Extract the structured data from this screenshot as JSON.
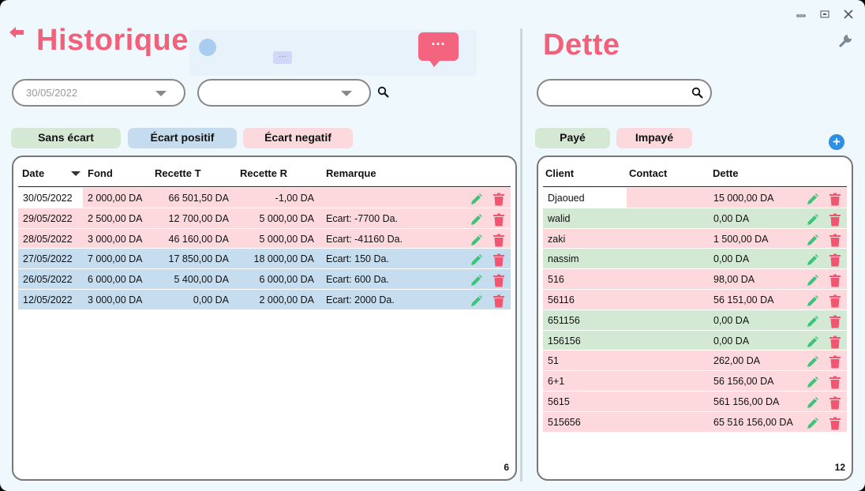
{
  "window": {
    "controls": [
      "minimize-icon",
      "restore-icon",
      "close-icon"
    ]
  },
  "historique": {
    "title": "Historique",
    "date_combo": {
      "value": "30/05/2022"
    },
    "second_combo": {
      "value": ""
    },
    "filters": {
      "sans_ecart": "Sans écart",
      "ecart_positif": "Écart positif",
      "ecart_negatif": "Écart negatif"
    },
    "columns": {
      "date": "Date",
      "fond": "Fond",
      "recette_t": "Recette T",
      "recette_r": "Recette R",
      "remarque": "Remarque"
    },
    "rows": [
      {
        "date": "30/05/2022",
        "fond": "2 000,00 DA",
        "recette_t": "66 501,50 DA",
        "recette_r": "-1,00 DA",
        "remarque": "",
        "status": "pink",
        "first": true
      },
      {
        "date": "29/05/2022",
        "fond": "2 500,00 DA",
        "recette_t": "12 700,00 DA",
        "recette_r": "5 000,00 DA",
        "remarque": "Ecart: -7700 Da.",
        "status": "pink"
      },
      {
        "date": "28/05/2022",
        "fond": "3 000,00 DA",
        "recette_t": "46 160,00 DA",
        "recette_r": "5 000,00 DA",
        "remarque": "Ecart: -41160 Da.",
        "status": "pink"
      },
      {
        "date": "27/05/2022",
        "fond": "7 000,00 DA",
        "recette_t": "17 850,00 DA",
        "recette_r": "18 000,00 DA",
        "remarque": "Ecart: 150 Da.",
        "status": "blue"
      },
      {
        "date": "26/05/2022",
        "fond": "6 000,00 DA",
        "recette_t": "5 400,00 DA",
        "recette_r": "6 000,00 DA",
        "remarque": "Ecart: 600 Da.",
        "status": "blue"
      },
      {
        "date": "12/05/2022",
        "fond": "3 000,00 DA",
        "recette_t": "0,00 DA",
        "recette_r": "2 000,00 DA",
        "remarque": "Ecart: 2000 Da.",
        "status": "blue"
      }
    ],
    "count": "6"
  },
  "dette": {
    "title": "Dette",
    "search": {
      "value": ""
    },
    "filters": {
      "paye": "Payé",
      "impaye": "Impayé"
    },
    "columns": {
      "client": "Client",
      "contact": "Contact",
      "dette": "Dette"
    },
    "rows": [
      {
        "client": "Djaoued",
        "contact": "",
        "dette": "15 000,00 DA",
        "status": "pink",
        "first": true
      },
      {
        "client": "walid",
        "contact": "",
        "dette": "0,00 DA",
        "status": "green"
      },
      {
        "client": "zaki",
        "contact": "",
        "dette": "1 500,00 DA",
        "status": "pink"
      },
      {
        "client": "nassim",
        "contact": "",
        "dette": "0,00 DA",
        "status": "green"
      },
      {
        "client": "516",
        "contact": "",
        "dette": "98,00 DA",
        "status": "pink"
      },
      {
        "client": "56116",
        "contact": "",
        "dette": "56 151,00 DA",
        "status": "pink"
      },
      {
        "client": "651156",
        "contact": "",
        "dette": "0,00 DA",
        "status": "green"
      },
      {
        "client": "156156",
        "contact": "",
        "dette": "0,00 DA",
        "status": "green"
      },
      {
        "client": "51",
        "contact": "",
        "dette": "262,00 DA",
        "status": "pink"
      },
      {
        "client": "6+1",
        "contact": "",
        "dette": "56 156,00 DA",
        "status": "pink"
      },
      {
        "client": "5615",
        "contact": "",
        "dette": "561 156,00 DA",
        "status": "pink"
      },
      {
        "client": "515656",
        "contact": "",
        "dette": "65 516 156,00 DA",
        "status": "pink"
      }
    ],
    "count": "12"
  },
  "colors": {
    "accent": "#f2607a",
    "pink_row": "#fdd8dc",
    "blue_row": "#c6ddf0",
    "green_row": "#d4e9d3",
    "edit": "#3cc47a",
    "delete": "#f0566f"
  }
}
